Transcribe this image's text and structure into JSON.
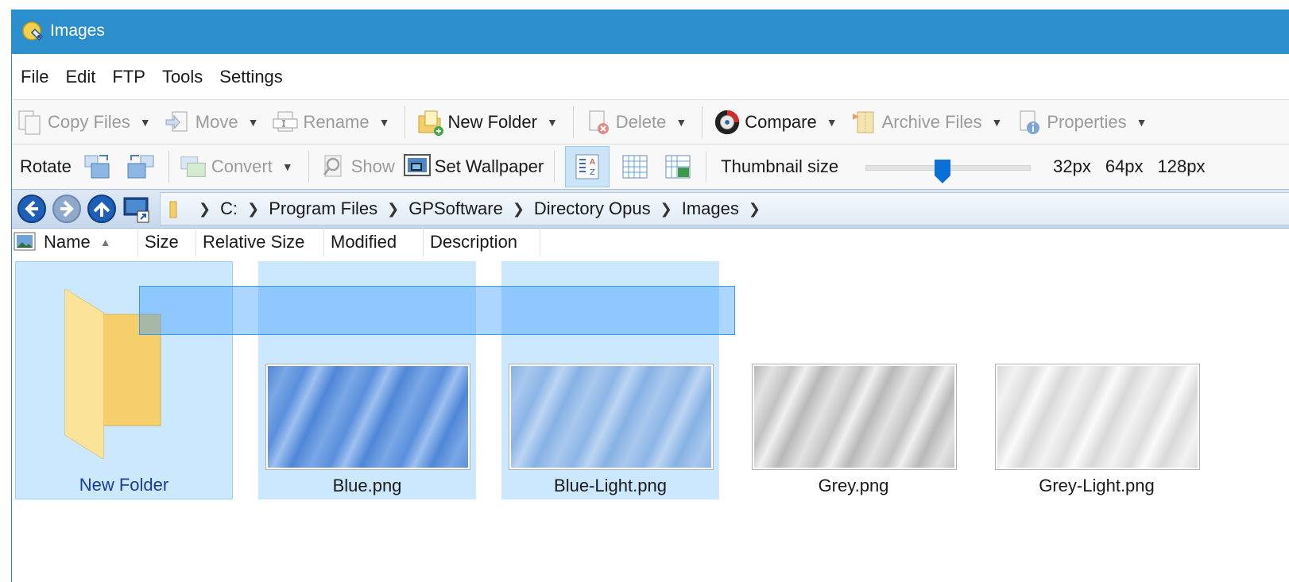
{
  "window": {
    "title": "Images"
  },
  "menu": [
    "File",
    "Edit",
    "FTP",
    "Tools",
    "Settings"
  ],
  "toolbar1": {
    "copy": "Copy Files",
    "move": "Move",
    "rename": "Rename",
    "new_folder": "New Folder",
    "delete": "Delete",
    "compare": "Compare",
    "archive": "Archive Files",
    "properties": "Properties"
  },
  "toolbar2": {
    "rotate": "Rotate",
    "convert": "Convert",
    "show": "Show",
    "set_wallpaper": "Set Wallpaper",
    "thumbnail_size": "Thumbnail size",
    "thumbnail_level": 0.47,
    "sizes": [
      "32px",
      "64px",
      "128px"
    ]
  },
  "breadcrumb": [
    "C:",
    "Program Files",
    "GPSoftware",
    "Directory Opus",
    "Images"
  ],
  "columns": [
    "Name",
    "Size",
    "Relative Size",
    "Modified",
    "Description"
  ],
  "files": [
    {
      "name": "New Folder",
      "type": "folder",
      "selected": true,
      "focused": true
    },
    {
      "name": "Blue.png",
      "type": "image",
      "color": "#5b95dc",
      "selected": true
    },
    {
      "name": "Blue-Light.png",
      "type": "image",
      "color": "#8fb8e6",
      "selected": true
    },
    {
      "name": "Grey.png",
      "type": "image",
      "color": "#c2c2c2",
      "selected": false
    },
    {
      "name": "Grey-Light.png",
      "type": "image",
      "color": "#e0e0e0",
      "selected": false
    }
  ],
  "colors": {
    "titlebar": "#2c8ecd",
    "selection": "#cce8ff",
    "marquee": "#3399ff"
  }
}
